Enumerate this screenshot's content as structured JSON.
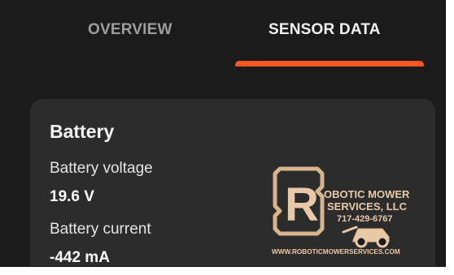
{
  "tabs": {
    "overview_label": "OVERVIEW",
    "sensor_label": "SENSOR DATA",
    "active": "SENSOR DATA"
  },
  "colors": {
    "background": "#1b1b1b",
    "card": "#2c2c2c",
    "accent": "#ff5722",
    "watermark": "#e7c9a8"
  },
  "battery_card": {
    "title": "Battery",
    "fields": [
      {
        "label": "Battery voltage",
        "value": "19.6 V"
      },
      {
        "label": "Battery current",
        "value": "-442 mA"
      }
    ]
  },
  "watermark": {
    "letter": "R",
    "line1": "OBOTIC MOWER",
    "line2": "SERVICES, LLC",
    "phone": "717-429-6767",
    "website": "WWW.ROBOTICMOWERSERVICES.COM"
  }
}
